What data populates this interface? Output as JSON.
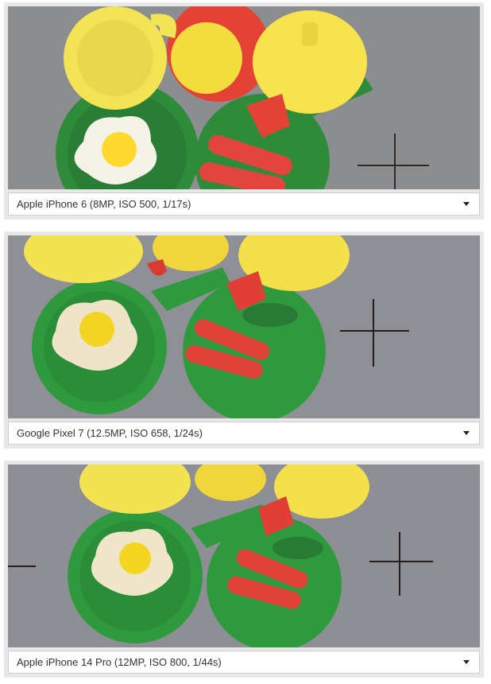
{
  "comparisons": [
    {
      "camera_label": "Apple iPhone 6 (8MP, ISO 500, 1/17s)",
      "image_subject": "toy food"
    },
    {
      "camera_label": "Google Pixel 7 (12.5MP, ISO 658, 1/24s)",
      "image_subject": "toy food"
    },
    {
      "camera_label": "Apple iPhone 14 Pro (12MP, ISO 800, 1/44s)",
      "image_subject": "toy food"
    }
  ],
  "icons": {
    "dropdown": "caret-down-icon"
  },
  "colors": {
    "panel_bg": "#e8e8e8",
    "select_bg": "#ffffff",
    "select_text": "#333333"
  }
}
